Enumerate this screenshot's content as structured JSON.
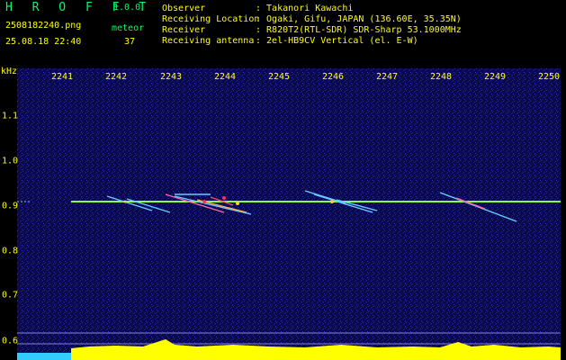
{
  "header": {
    "app_name": "H R O F F T",
    "version": "1.0.0",
    "filename": "2508182240.png",
    "datetime": "25.08.18 22:40",
    "mode_label": "meteor",
    "count": "37",
    "info": [
      {
        "label": "Observer",
        "value": ": Takanori Kawachi"
      },
      {
        "label": "Receiving Location",
        "value": ": Ogaki, Gifu, JAPAN (136.60E, 35.35N)"
      },
      {
        "label": "Receiver",
        "value": ": R820T2(RTL-SDR) SDR-Sharp 53.1000MHz"
      },
      {
        "label": "Receiving antenna",
        "value": ": 2el-HB9CV Vertical (el. E-W)"
      }
    ]
  },
  "axes": {
    "y_unit": "kHz",
    "x_labels": [
      "2241",
      "2242",
      "2243",
      "2244",
      "2245",
      "2246",
      "2247",
      "2248",
      "2249",
      "2250"
    ],
    "y_labels": [
      "1.1",
      "1.0",
      "0.9",
      "0.8",
      "0.7",
      "0.6"
    ]
  },
  "colors": {
    "background": "#000000",
    "text": "#ffff00",
    "title": "#00ff66",
    "carrier": "#88ff44",
    "level_bar": "#ffff00",
    "level_bar_left": "#33ccff"
  }
}
